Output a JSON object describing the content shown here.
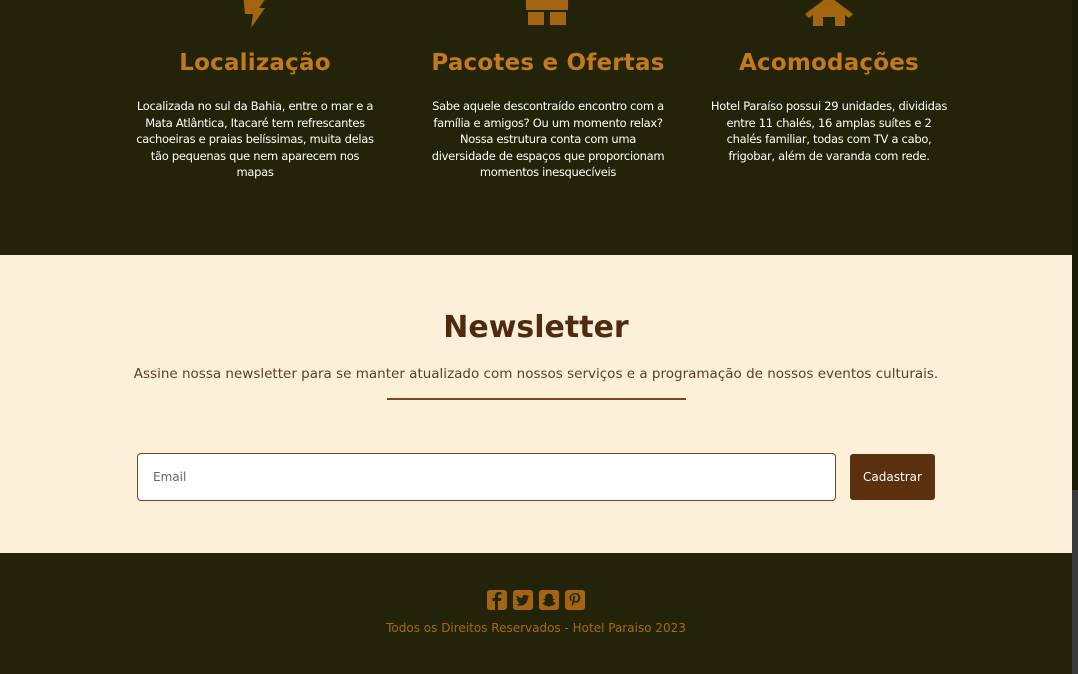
{
  "colors": {
    "dark_bg": "#222308",
    "cream_bg": "#fdf0d8",
    "accent_gold": "#c27a1a",
    "brown": "#5b300f",
    "heading_brown": "#4e2a0e"
  },
  "features": [
    {
      "icon": "plane-icon",
      "title": "Localização",
      "text": "Localizada no sul da Bahia, entre o mar e a Mata Atlântica, Itacaré tem refrescantes cachoeiras e praias belíssimas, muita delas tão pequenas que nem aparecem nos mapas"
    },
    {
      "icon": "gift-icon",
      "title": "Pacotes e Ofertas",
      "text": "Sabe aquele descontraído encontro com a família e amigos? Ou um momento relax? Nossa estrutura conta com uma diversidade de espaços que proporcionam momentos inesquecíveis"
    },
    {
      "icon": "house-icon",
      "title": "Acomodações",
      "text": "Hotel Paraíso possui 29 unidades, divididas entre 11 chalés, 16 amplas suítes e 2 chalés familiar, todas com TV a cabo, frigobar, além de varanda com rede."
    }
  ],
  "newsletter": {
    "title": "Newsletter",
    "subtitle": "Assine nossa newsletter para se manter atualizado com nossos serviços e a programação de nossos eventos culturais.",
    "email_placeholder": "Email",
    "email_value": "",
    "submit_label": "Cadastrar"
  },
  "footer": {
    "social": [
      "facebook-icon",
      "twitter-icon",
      "snapchat-icon",
      "pinterest-icon"
    ],
    "copyright": "Todos os Direitos Reservados - Hotel Paraiso 2023"
  }
}
